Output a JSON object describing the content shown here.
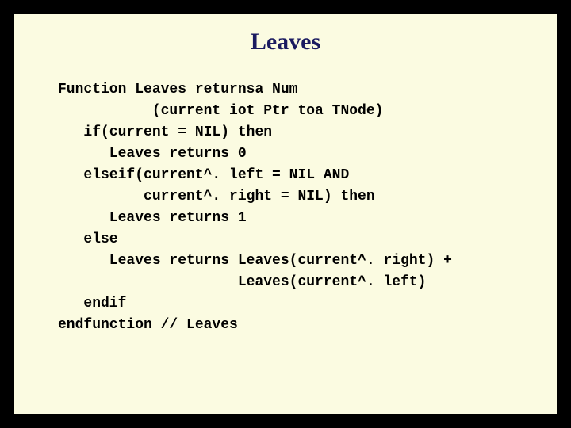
{
  "slide": {
    "title": "Leaves",
    "code": "Function Leaves returnsa Num\n           (current iot Ptr toa TNode)\n   if(current = NIL) then\n      Leaves returns 0\n   elseif(current^. left = NIL AND\n          current^. right = NIL) then\n      Leaves returns 1\n   else\n      Leaves returns Leaves(current^. right) +\n                     Leaves(current^. left)\n   endif\nendfunction // Leaves"
  }
}
